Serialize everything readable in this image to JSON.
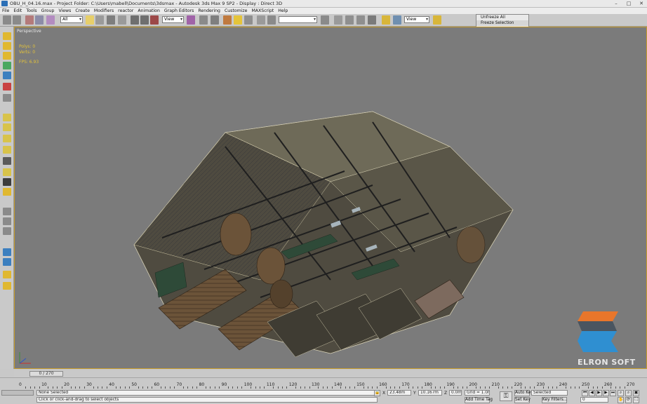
{
  "window": {
    "title": "OBU_H_04.16.max    - Project Folder: C:\\Users\\mabell\\Documents\\3dsmax    - Autodesk 3ds Max 9 SP2    - Display : Direct 3D",
    "minimize": "–",
    "maximize": "□",
    "close": "✕"
  },
  "menu": [
    "File",
    "Edit",
    "Tools",
    "Group",
    "Views",
    "Create",
    "Modifiers",
    "reactor",
    "Animation",
    "Graph Editors",
    "Rendering",
    "Customize",
    "MAXScript",
    "Help"
  ],
  "toolbar": {
    "selection_filter": "All",
    "reference_coord": "View",
    "named_selection": "",
    "render_view": "View",
    "selection_sets": [
      "Unfreeze All",
      "Freeze Selection"
    ]
  },
  "viewport": {
    "label": "Perspective",
    "stats": {
      "polys": "Polys: 0",
      "verts": "Verts: 0",
      "fps": "FPS:    6.93"
    }
  },
  "logo": {
    "text": "ELRON SOFT",
    "colors": {
      "orange": "#e8762b",
      "blue": "#2f8fd1",
      "gray": "#5a6670"
    }
  },
  "timeline": {
    "position": "0 / 270",
    "ticks": [
      "0",
      "10",
      "20",
      "30",
      "40",
      "50",
      "60",
      "70",
      "80",
      "90",
      "100",
      "110",
      "120",
      "130",
      "140",
      "150",
      "160",
      "170",
      "180",
      "190",
      "200",
      "210",
      "220",
      "230",
      "240",
      "250",
      "260",
      "270"
    ]
  },
  "status": {
    "selection": "None Selected",
    "prompt": "Click or click-and-drag to select objects",
    "x_label": "X",
    "x_value": "23.48m",
    "y_label": "Y",
    "y_value": "10.167m",
    "z_label": "Z",
    "z_value": "0.0m",
    "grid": "Grid = 1.0m",
    "add_time_tag": "Add Time Tag",
    "auto_key": "Auto Key",
    "auto_key_mode": "Selected",
    "set_key": "Set Key",
    "key_filters": "Key Filters...",
    "frame": "0"
  }
}
